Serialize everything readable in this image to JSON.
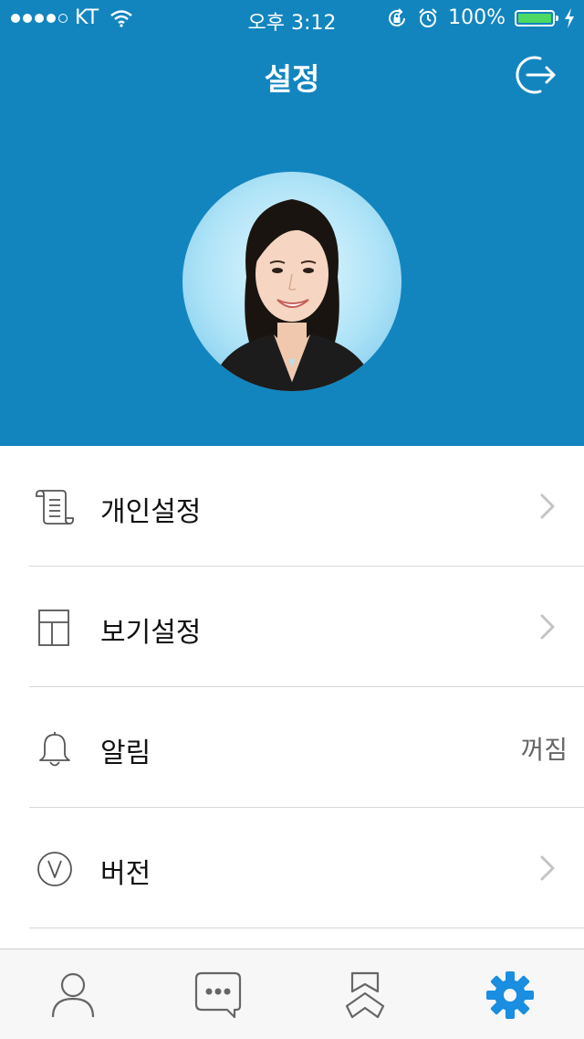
{
  "status_bar": {
    "carrier": "KT",
    "time": "오후 3:12",
    "battery": "100%"
  },
  "header": {
    "title": "설정"
  },
  "menu": {
    "items": [
      {
        "label": "개인설정",
        "icon": "scroll-icon"
      },
      {
        "label": "보기설정",
        "icon": "layout-icon"
      },
      {
        "label": "알림",
        "icon": "bell-icon",
        "value": "꺼짐"
      },
      {
        "label": "버전",
        "icon": "version-v-icon"
      }
    ]
  },
  "tabbar": {
    "tabs": [
      {
        "icon": "person-icon"
      },
      {
        "icon": "chat-icon"
      },
      {
        "icon": "bookmark-icon"
      },
      {
        "icon": "gear-icon",
        "active": true
      }
    ]
  },
  "colors": {
    "header_bg": "#1285bf",
    "accent": "#1a8ee0",
    "battery": "#4cd964"
  }
}
